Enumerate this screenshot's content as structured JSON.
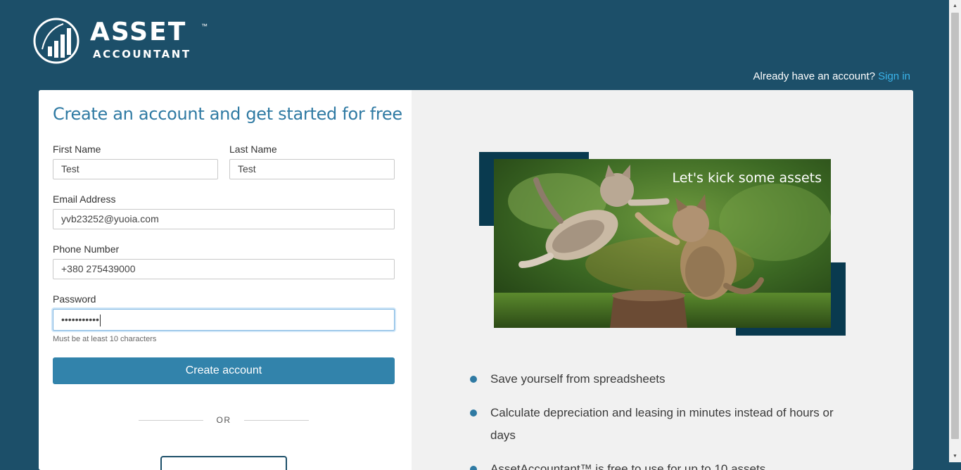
{
  "brand": {
    "name": "ASSET",
    "tm": "™",
    "sub": "ACCOUNTANT"
  },
  "header": {
    "have_account": "Already have an account?",
    "signin_link": "Sign in"
  },
  "form": {
    "title": "Create an account and get started for free",
    "first_name": {
      "label": "First Name",
      "value": "Test"
    },
    "last_name": {
      "label": "Last Name",
      "value": "Test"
    },
    "email": {
      "label": "Email Address",
      "value": "yvb23252@yuoia.com"
    },
    "phone": {
      "label": "Phone Number",
      "value": "+380 275439000"
    },
    "password": {
      "label": "Password",
      "value": "•••••••••••"
    },
    "password_hint": "Must be at least 10 characters",
    "create_button": "Create account",
    "or_text": "OR"
  },
  "promo": {
    "tagline": "Let's kick some assets",
    "bullets": [
      "Save yourself from spreadsheets",
      "Calculate depreciation and leasing in minutes instead of hours or days",
      "AssetAccountant™ is free to use for up to 10 assets"
    ]
  },
  "colors": {
    "header_bg": "#1c4f69",
    "accent": "#2f7aa3",
    "button": "#3283ab",
    "link": "#3ab3ea",
    "deco": "#093a4f"
  }
}
